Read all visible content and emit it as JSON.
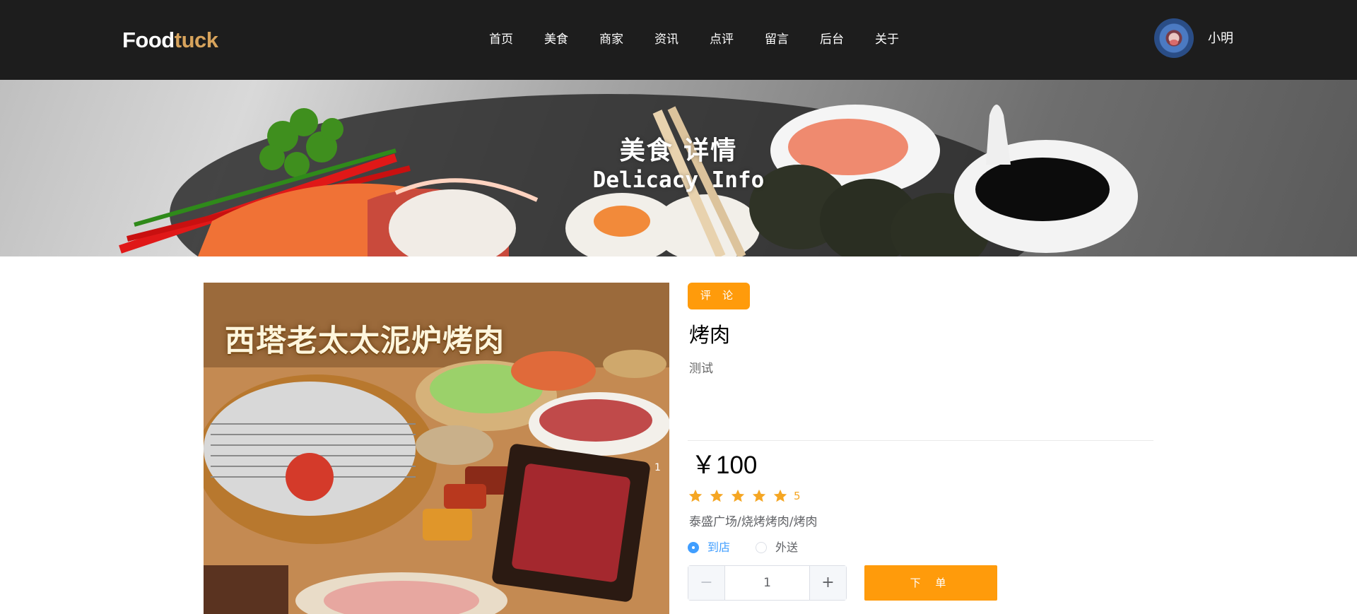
{
  "header": {
    "logo_part1": "Food",
    "logo_part2": "tuck",
    "nav": [
      "首页",
      "美食",
      "商家",
      "资讯",
      "点评",
      "留言",
      "后台",
      "关于"
    ],
    "username": "小明"
  },
  "banner": {
    "title": "美食 详情",
    "subtitle": "Delicacy Info"
  },
  "product": {
    "image_text": "西塔老太太泥炉烤肉",
    "image_page_marker": "1",
    "comment_label": "评 论",
    "name": "烤肉",
    "description": "测试",
    "price": "￥100",
    "rating": 5,
    "rating_label": "5",
    "location": "泰盛广场/烧烤烤肉/烤肉",
    "delivery_options": [
      "到店",
      "外送"
    ],
    "selected_option": "到店",
    "quantity": "1",
    "minus_label": "−",
    "plus_label": "+",
    "order_label": "下 单"
  },
  "colors": {
    "header_bg": "#1d1d1d",
    "logo_accent": "#d7a35c",
    "accent_orange": "#ff9b0b",
    "star": "#f5a623",
    "radio_active": "#409eff"
  }
}
